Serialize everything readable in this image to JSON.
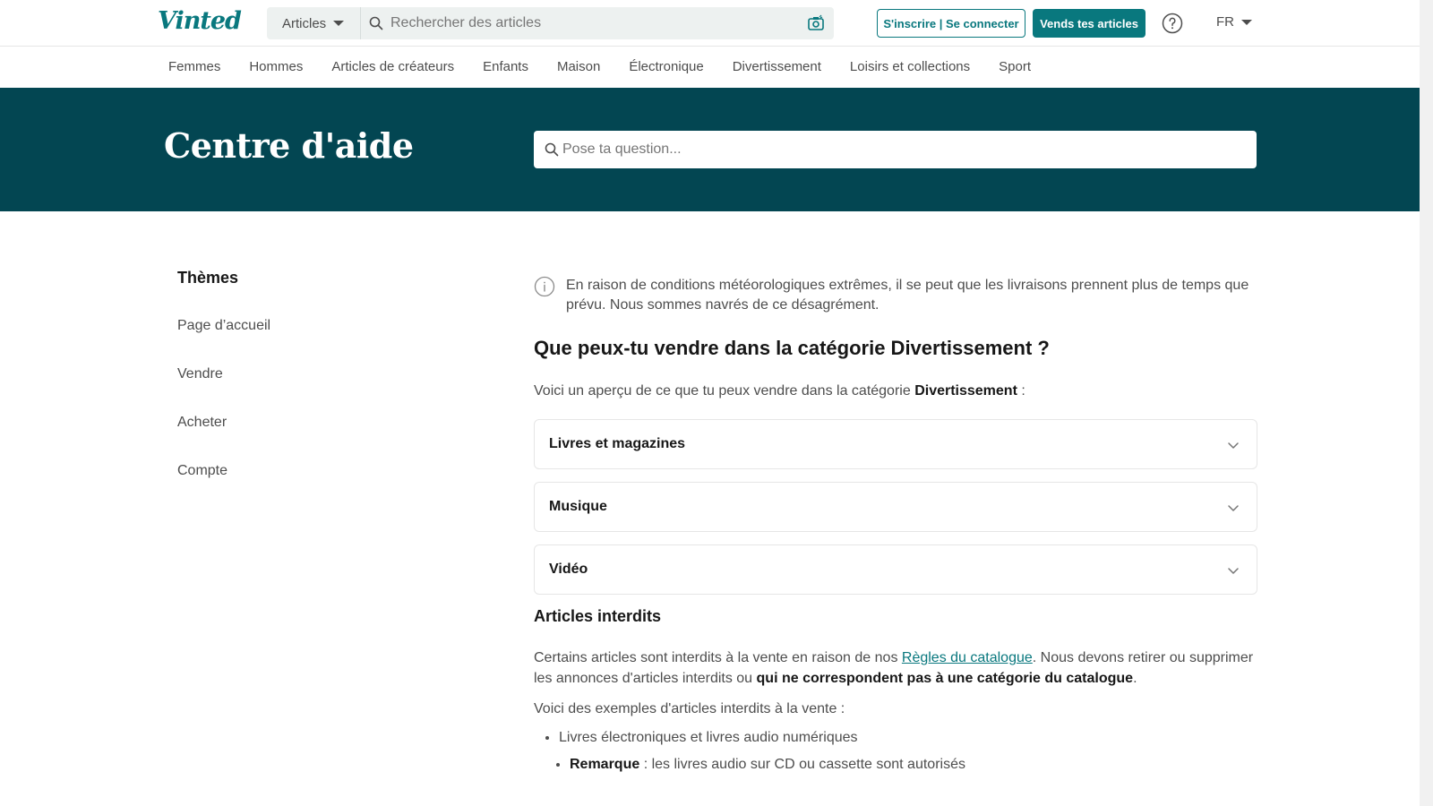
{
  "header": {
    "logo": "Vinted",
    "category_select": "Articles",
    "search_placeholder": "Rechercher des articles",
    "login_label": "S'inscrire | Se connecter",
    "sell_label": "Vends tes articles",
    "language": "FR",
    "accent_color": "#09787e"
  },
  "catnav": {
    "items": [
      "Femmes",
      "Hommes",
      "Articles de créateurs",
      "Enfants",
      "Maison",
      "Électronique",
      "Divertissement",
      "Loisirs et collections",
      "Sport"
    ]
  },
  "hero": {
    "title": "Centre d'aide",
    "search_placeholder": "Pose ta question...",
    "background_color": "#034652"
  },
  "sidebar": {
    "title": "Thèmes",
    "items": [
      "Page d’accueil",
      "Vendre",
      "Acheter",
      "Compte"
    ]
  },
  "main": {
    "notice": "En raison de conditions météorologiques extrêmes, il se peut que les livraisons prennent plus de temps que prévu. Nous sommes navrés de ce désagrément.",
    "title": "Que peux-tu vendre dans la catégorie Divertissement ?",
    "intro_prefix": "Voici un aperçu de ce que tu peux vendre dans la catégorie ",
    "intro_bold": "Divertissement",
    "intro_suffix": " :",
    "accordion": [
      "Livres et magazines",
      "Musique",
      "Vidéo"
    ],
    "forbidden_title": "Articles interdits",
    "forbidden_p1_prefix": "Certains articles sont interdits à la vente en raison de nos ",
    "forbidden_p1_link": "Règles du catalogue",
    "forbidden_p1_middle": ". Nous devons retirer ou supprimer les annonces d'articles interdits ou ",
    "forbidden_p1_bold": "qui ne correspondent pas à une catégorie du catalogue",
    "forbidden_p1_end": ".",
    "examples_intro": "Voici des exemples d'articles interdits à la vente :",
    "bullet_1": "Livres électroniques et livres audio numériques",
    "sub_bullet_bold": "Remarque",
    "sub_bullet_text": " : les livres audio sur CD ou cassette sont autorisés"
  }
}
